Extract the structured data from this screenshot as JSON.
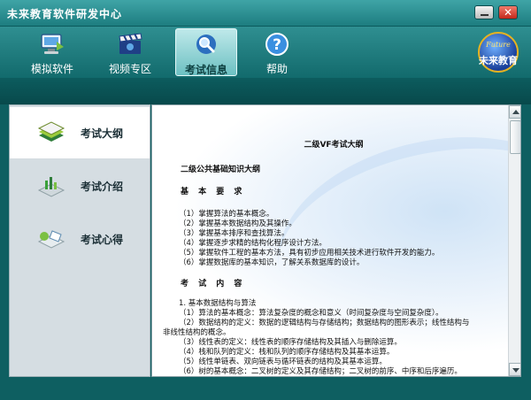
{
  "window": {
    "title": "未来教育软件研发中心",
    "close_glyph": "✕"
  },
  "toolbar": {
    "items": [
      {
        "label": "模拟软件",
        "icon": "computer-icon"
      },
      {
        "label": "视频专区",
        "icon": "film-clapper-icon"
      },
      {
        "label": "考试信息",
        "icon": "magnifier-icon",
        "active": true
      },
      {
        "label": "帮助",
        "icon": "help-icon"
      }
    ]
  },
  "logo": {
    "script_text": "Future",
    "text": "未来教育"
  },
  "sidebar": {
    "items": [
      {
        "label": "考试大纲",
        "icon": "books-icon",
        "active": true
      },
      {
        "label": "考试介绍",
        "icon": "chart-icon"
      },
      {
        "label": "考试心得",
        "icon": "notes-icon"
      }
    ]
  },
  "document": {
    "title": "二级VF考试大纲",
    "subtitle": "二级公共基础知识大纲",
    "section1": "基 本 要 求",
    "reqs": [
      "（1）掌握算法的基本概念。",
      "（2）掌握基本数据结构及其操作。",
      "（3）掌握基本排序和查找算法。",
      "（4）掌握逐步求精的结构化程序设计方法。",
      "（5）掌握软件工程的基本方法，具有初步应用相关技术进行软件开发的能力。",
      "（6）掌握数据库的基本知识，了解关系数据库的设计。"
    ],
    "section2": "考 试 内 容",
    "content_lines": [
      "1. 基本数据结构与算法",
      "（1）算法的基本概念：算法复杂度的概念和意义（时间复杂度与空间复杂度）。",
      "（2）数据结构的定义：数据的逻辑结构与存储结构；数据结构的图形表示；线性结构与",
      "非线性结构的概念。",
      "（3）线性表的定义：线性表的顺序存储结构及其插入与删除运算。",
      "（4）栈和队列的定义：栈和队列的顺序存储结构及其基本运算。",
      "（5）线性单链表、双向链表与循环链表的结构及其基本运算。",
      "（6）树的基本概念：二叉树的定义及其存储结构；二叉树的前序、中序和后序遍历。"
    ]
  },
  "colors": {
    "frame": "#0e5f61",
    "toolbar_top": "#2f8f91",
    "active_tool": "#8fd3d5",
    "sidebar": "#d5dde2"
  }
}
